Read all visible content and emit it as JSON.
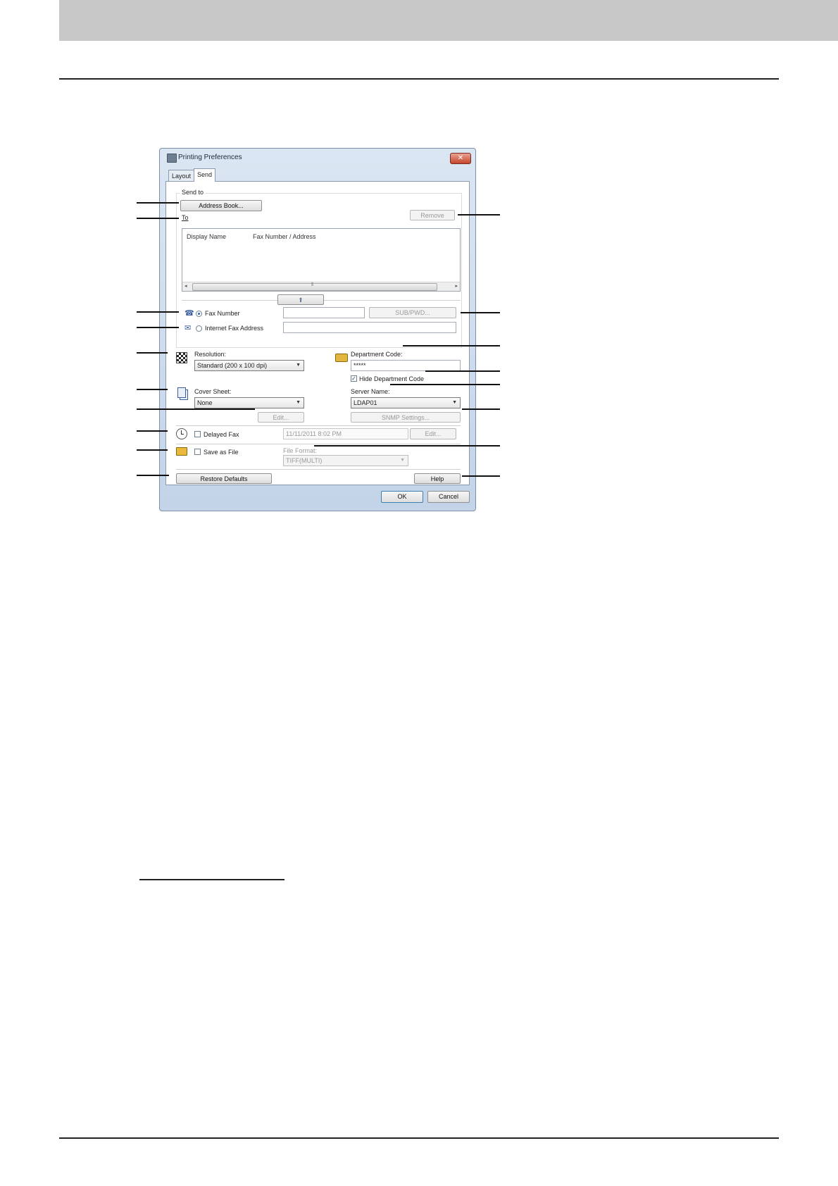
{
  "dialog": {
    "title": "Printing Preferences",
    "close_glyph": "✕",
    "tabs": [
      {
        "label": "Layout",
        "active": false
      },
      {
        "label": "Send",
        "active": true
      }
    ]
  },
  "send_to": {
    "group_label": "Send to",
    "address_book_label": "Address Book...",
    "remove_label": "Remove",
    "to_label": "To",
    "list_columns": [
      "Display Name",
      "Fax Number / Address"
    ],
    "scroll_left": "◂",
    "scroll_right": "▸",
    "scroll_grip": "⦀",
    "add_arrow": "⬆",
    "fax_number_label": "Fax Number",
    "fax_number_value": "",
    "sub_pwd_label": "SUB/PWD...",
    "internet_fax_label": "Internet Fax Address",
    "internet_fax_value": ""
  },
  "resolution": {
    "label": "Resolution:",
    "value": "Standard (200 x 100 dpi)"
  },
  "department": {
    "label": "Department Code:",
    "value": "*****",
    "hide_label": "Hide Department Code",
    "hide_checked": "✓"
  },
  "cover_sheet": {
    "label": "Cover Sheet:",
    "value": "None",
    "edit_label": "Edit..."
  },
  "server": {
    "label": "Server Name:",
    "value": "LDAP01",
    "snmp_label": "SNMP Settings..."
  },
  "delayed_fax": {
    "label": "Delayed Fax",
    "datetime": "11/11/2011 8:02 PM",
    "edit_label": "Edit..."
  },
  "save_as_file": {
    "label": "Save as File",
    "format_label": "File Format:",
    "format_value": "TIFF(MULTI)"
  },
  "buttons": {
    "restore": "Restore Defaults",
    "help": "Help",
    "ok": "OK",
    "cancel": "Cancel"
  },
  "icons": {
    "fax": "fax-icon",
    "internet_fax": "email-icon",
    "resolution": "checker-icon",
    "department": "key-icon",
    "cover": "pages-icon",
    "clock": "clock-icon",
    "folder": "folder-icon"
  },
  "colors": {
    "accent": "#1d5fbf",
    "disabled_text": "#9a9a9a",
    "header_band": "#c8c8c8"
  }
}
